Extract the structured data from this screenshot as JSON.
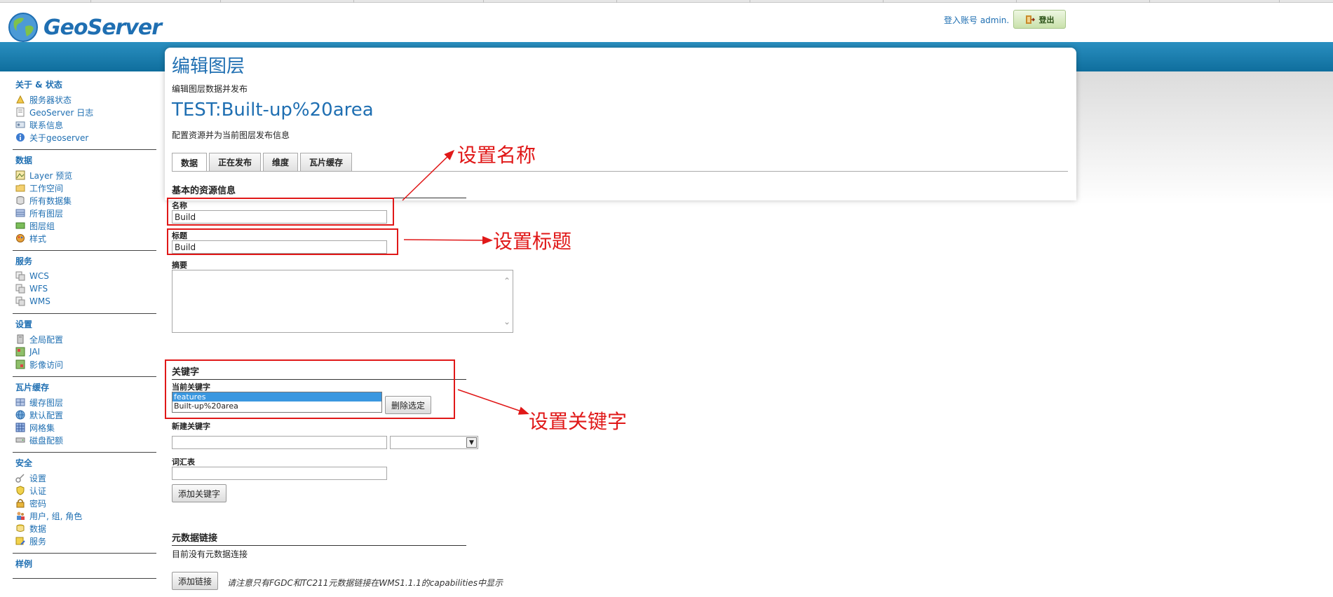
{
  "header": {
    "logo_text": "GeoServer",
    "login_text": "登入账号 admin.",
    "logout_label": "登出"
  },
  "sidebar": {
    "sections": [
      {
        "title": "关于 & 状态",
        "items": [
          {
            "label": "服务器状态",
            "icon": "server-status-icon"
          },
          {
            "label": "GeoServer 日志",
            "icon": "log-icon"
          },
          {
            "label": "联系信息",
            "icon": "contact-icon"
          },
          {
            "label": "关于geoserver",
            "icon": "about-icon"
          }
        ]
      },
      {
        "title": "数据",
        "items": [
          {
            "label": "Layer 预览",
            "icon": "layer-preview-icon"
          },
          {
            "label": "工作空间",
            "icon": "folder-icon"
          },
          {
            "label": "所有数据集",
            "icon": "store-icon"
          },
          {
            "label": "所有图层",
            "icon": "layers-icon"
          },
          {
            "label": "图层组",
            "icon": "layer-group-icon"
          },
          {
            "label": "样式",
            "icon": "style-icon"
          }
        ]
      },
      {
        "title": "服务",
        "items": [
          {
            "label": "WCS",
            "icon": "service-icon"
          },
          {
            "label": "WFS",
            "icon": "service-icon"
          },
          {
            "label": "WMS",
            "icon": "service-icon"
          }
        ]
      },
      {
        "title": "设置",
        "items": [
          {
            "label": "全局配置",
            "icon": "global-settings-icon"
          },
          {
            "label": "JAI",
            "icon": "jai-icon"
          },
          {
            "label": "影像访问",
            "icon": "coverage-icon"
          }
        ]
      },
      {
        "title": "瓦片缓存",
        "items": [
          {
            "label": "缓存图层",
            "icon": "tile-layers-icon"
          },
          {
            "label": "默认配置",
            "icon": "globe-icon"
          },
          {
            "label": "网格集",
            "icon": "grid-icon"
          },
          {
            "label": "磁盘配额",
            "icon": "disk-icon"
          }
        ]
      },
      {
        "title": "安全",
        "items": [
          {
            "label": "设置",
            "icon": "key-icon"
          },
          {
            "label": "认证",
            "icon": "shield-icon"
          },
          {
            "label": "密码",
            "icon": "lock-icon"
          },
          {
            "label": "用户, 组, 角色",
            "icon": "users-icon"
          },
          {
            "label": "数据",
            "icon": "data-security-icon"
          },
          {
            "label": "服务",
            "icon": "service-security-icon"
          }
        ]
      },
      {
        "title": "样例",
        "items": []
      }
    ]
  },
  "main": {
    "page_title": "编辑图层",
    "page_desc": "编辑图层数据并发布",
    "layer_name": "TEST:Built-up%20area",
    "layer_desc": "配置资源并为当前图层发布信息",
    "tabs": [
      "数据",
      "正在发布",
      "维度",
      "瓦片缓存"
    ],
    "basic_section": "基本的资源信息",
    "name_label": "名称",
    "name_value": "Build",
    "title_label": "标题",
    "title_value": "Build",
    "abstract_label": "摘要",
    "keywords_section": "关键字",
    "current_keywords_label": "当前关键字",
    "current_keywords": [
      "features",
      "Built-up%20area"
    ],
    "remove_selected_label": "删除选定",
    "new_keyword_label": "新建关键字",
    "vocabulary_label": "词汇表",
    "add_keyword_label": "添加关键字",
    "metadata_section": "元数据链接",
    "no_metadata_text": "目前没有元数据连接",
    "add_link_label": "添加链接",
    "metadata_note": "请注意只有FGDC和TC211元数据链接在WMS1.1.1的capabilities中显示"
  },
  "annotations": {
    "set_name": "设置名称",
    "set_title": "设置标题",
    "set_keywords": "设置关键字",
    "color": "#e01818"
  }
}
